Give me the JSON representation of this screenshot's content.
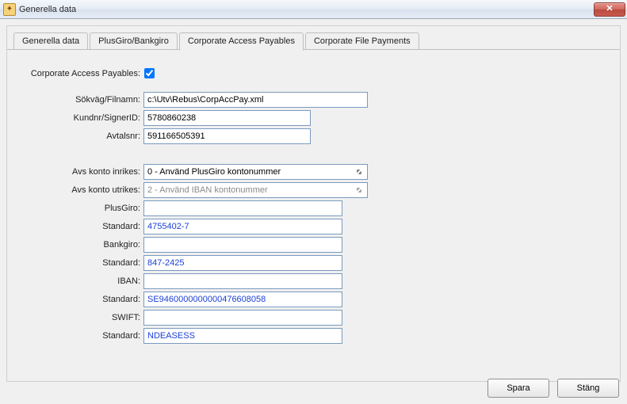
{
  "window": {
    "title": "Generella data"
  },
  "tabs": [
    {
      "label": "Generella data"
    },
    {
      "label": "PlusGiro/Bankgiro"
    },
    {
      "label": "Corporate Access Payables"
    },
    {
      "label": "Corporate File Payments"
    }
  ],
  "cap": {
    "enable_label": "Corporate Access Payables:",
    "enable_checked": true,
    "path_label": "Sökväg/Filnamn:",
    "path_value": "c:\\Utv\\Rebus\\CorpAccPay.xml",
    "customer_label": "Kundnr/SignerID:",
    "customer_value": "5780860238",
    "agreement_label": "Avtalsnr:",
    "agreement_value": "591166505391",
    "domestic_label": "Avs konto inrikes:",
    "domestic_value": "0  - Använd PlusGiro kontonummer",
    "foreign_label": "Avs konto utrikes:",
    "foreign_value": "2  - Använd IBAN kontonummer",
    "plusgiro_label": "PlusGiro:",
    "plusgiro_value": "",
    "standard1_label": "Standard:",
    "standard1_value": "4755402-7",
    "bankgiro_label": "Bankgiro:",
    "bankgiro_value": "",
    "standard2_label": "Standard:",
    "standard2_value": "847-2425",
    "iban_label": "IBAN:",
    "iban_value": "",
    "standard3_label": "Standard:",
    "standard3_value": "SE9460000000000476608058",
    "swift_label": "SWIFT:",
    "swift_value": "",
    "standard4_label": "Standard:",
    "standard4_value": "NDEASESS"
  },
  "buttons": {
    "save": "Spara",
    "close": "Stäng"
  }
}
